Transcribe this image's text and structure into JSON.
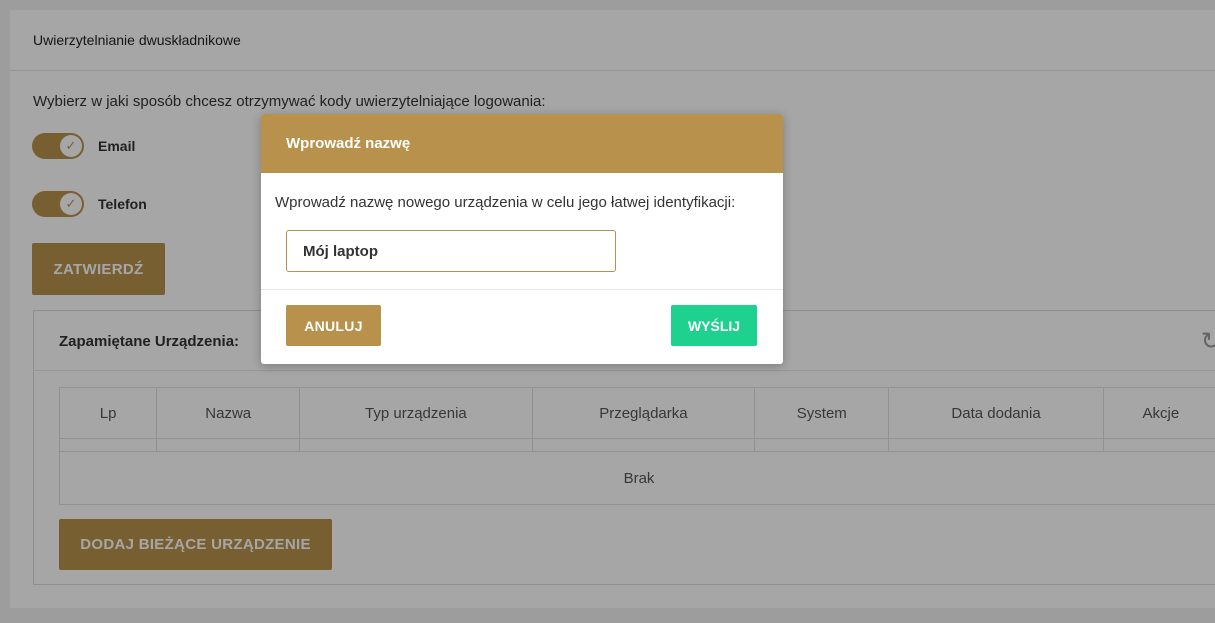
{
  "card": {
    "title": "Uwierzytelnianie dwuskładnikowe",
    "instruction": "Wybierz w jaki sposób chcesz otrzymywać kody uwierzytelniające logowania:"
  },
  "toggles": [
    {
      "label": "Email",
      "checked": true
    },
    {
      "label": "Telefon",
      "checked": true
    }
  ],
  "confirm_label": "ZATWIERDŹ",
  "devices": {
    "title": "Zapamiętane Urządzenia:",
    "columns": [
      "Lp",
      "Nazwa",
      "Typ urządzenia",
      "Przeglądarka",
      "System",
      "Data dodania",
      "Akcje"
    ],
    "empty_text": "Brak",
    "add_label": "DODAJ BIEŻĄCE URZĄDZENIE"
  },
  "modal": {
    "title": "Wprowadź nazwę",
    "text": "Wprowadź nazwę nowego urządzenia w celu jego łatwej identyfikacji:",
    "input_value": "Mój laptop",
    "cancel_label": "ANULUJ",
    "send_label": "WYŚLIJ"
  },
  "colors": {
    "accent": "#b8924c",
    "send": "#1fd18f"
  },
  "icons": {
    "refresh": "refresh-icon",
    "check": "check-icon"
  }
}
